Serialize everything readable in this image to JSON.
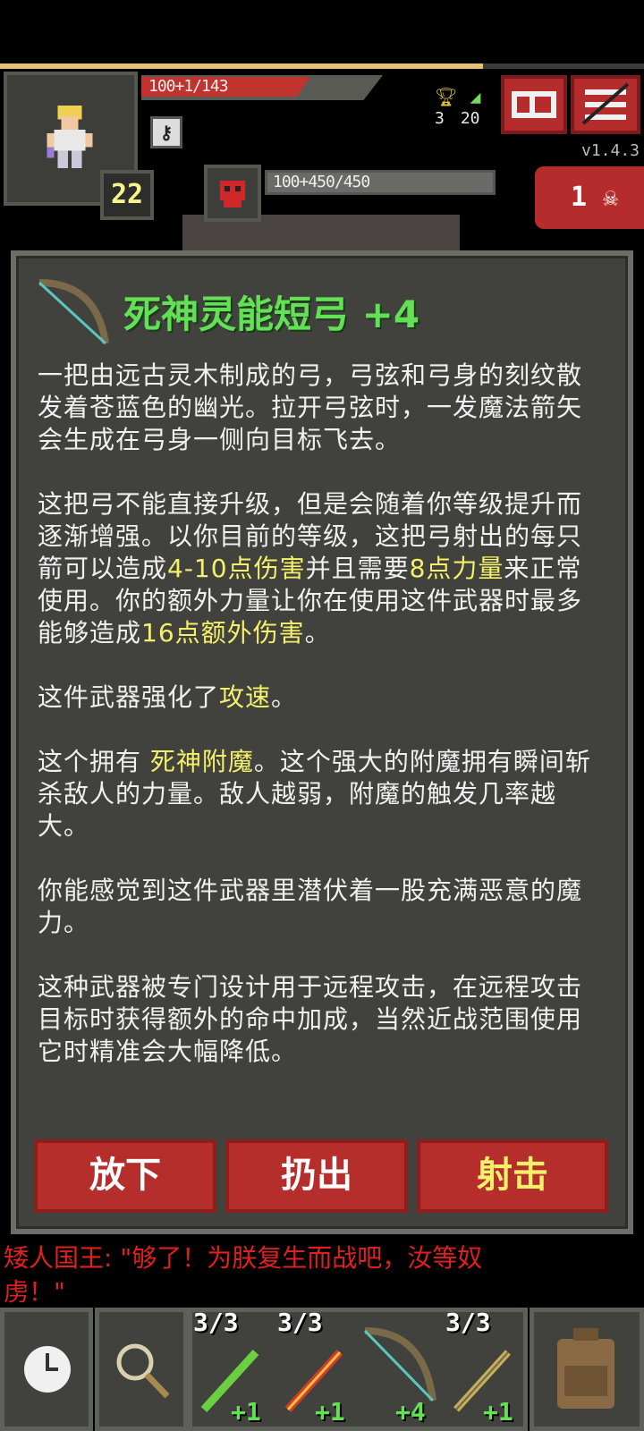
{
  "hud": {
    "hp_text": "100+1/143",
    "hp_fraction": 0.7,
    "level": "22",
    "key_icon": "iron-key-icon",
    "stats": {
      "trophies": "3",
      "depth": "20"
    },
    "version": "v1.4.3",
    "enemy_hp_text": "100+450/450",
    "danger_count": "1",
    "xp_fraction": 0.75
  },
  "item": {
    "title": "死神灵能短弓 +4",
    "paragraphs": [
      [
        {
          "t": "一把由远古灵木制成的弓，弓弦和弓身的刻纹散发着苍蓝色的幽光。拉开弓弦时，一发魔法箭矢会生成在弓身一侧向目标飞去。"
        }
      ],
      [
        {
          "t": "这把弓不能直接升级，但是会随着你等级提升而逐渐增强。以你目前的等级，这把弓射出的每只箭可以造成"
        },
        {
          "t": "4-10点伤害",
          "hl": true
        },
        {
          "t": "并且需要"
        },
        {
          "t": "8点力量",
          "hl": true
        },
        {
          "t": "来正常使用。你的额外力量让你在使用这件武器时最多能够造成"
        },
        {
          "t": "16点额外伤害",
          "hl": true
        },
        {
          "t": "。"
        }
      ],
      [
        {
          "t": "这件武器强化了"
        },
        {
          "t": "攻速",
          "hl": true
        },
        {
          "t": "。"
        }
      ],
      [
        {
          "t": "这个拥有 "
        },
        {
          "t": "死神附魔",
          "hl": true
        },
        {
          "t": "。这个强大的附魔拥有瞬间斩杀敌人的力量。敌人越弱，附魔的触发几率越大。"
        }
      ],
      [
        {
          "t": "你能感觉到这件武器里潜伏着一股充满恶意的魔力。"
        }
      ],
      [
        {
          "t": "这种武器被专门设计用于远程攻击，在远程攻击目标时获得额外的命中加成，当然近战范围使用它时精准会大幅降低。"
        }
      ]
    ],
    "buttons": {
      "drop": "放下",
      "throw": "扔出",
      "shoot": "射击"
    }
  },
  "chat": {
    "line": "矮人国王: \"够了！为朕复生而战吧，汝等奴虏！\""
  },
  "toolbar": {
    "slots": [
      {
        "charges": "3/3",
        "upgrade": "+1",
        "icon": "green-wand-icon"
      },
      {
        "charges": "3/3",
        "upgrade": "+1",
        "icon": "fire-wand-icon"
      },
      {
        "charges": "",
        "upgrade": "+4",
        "icon": "bow-icon"
      },
      {
        "charges": "3/3",
        "upgrade": "+1",
        "icon": "gold-wand-icon"
      }
    ]
  },
  "colors": {
    "accent_red": "#b62e2b",
    "highlight": "#f5f06b",
    "title_green": "#63e055"
  }
}
